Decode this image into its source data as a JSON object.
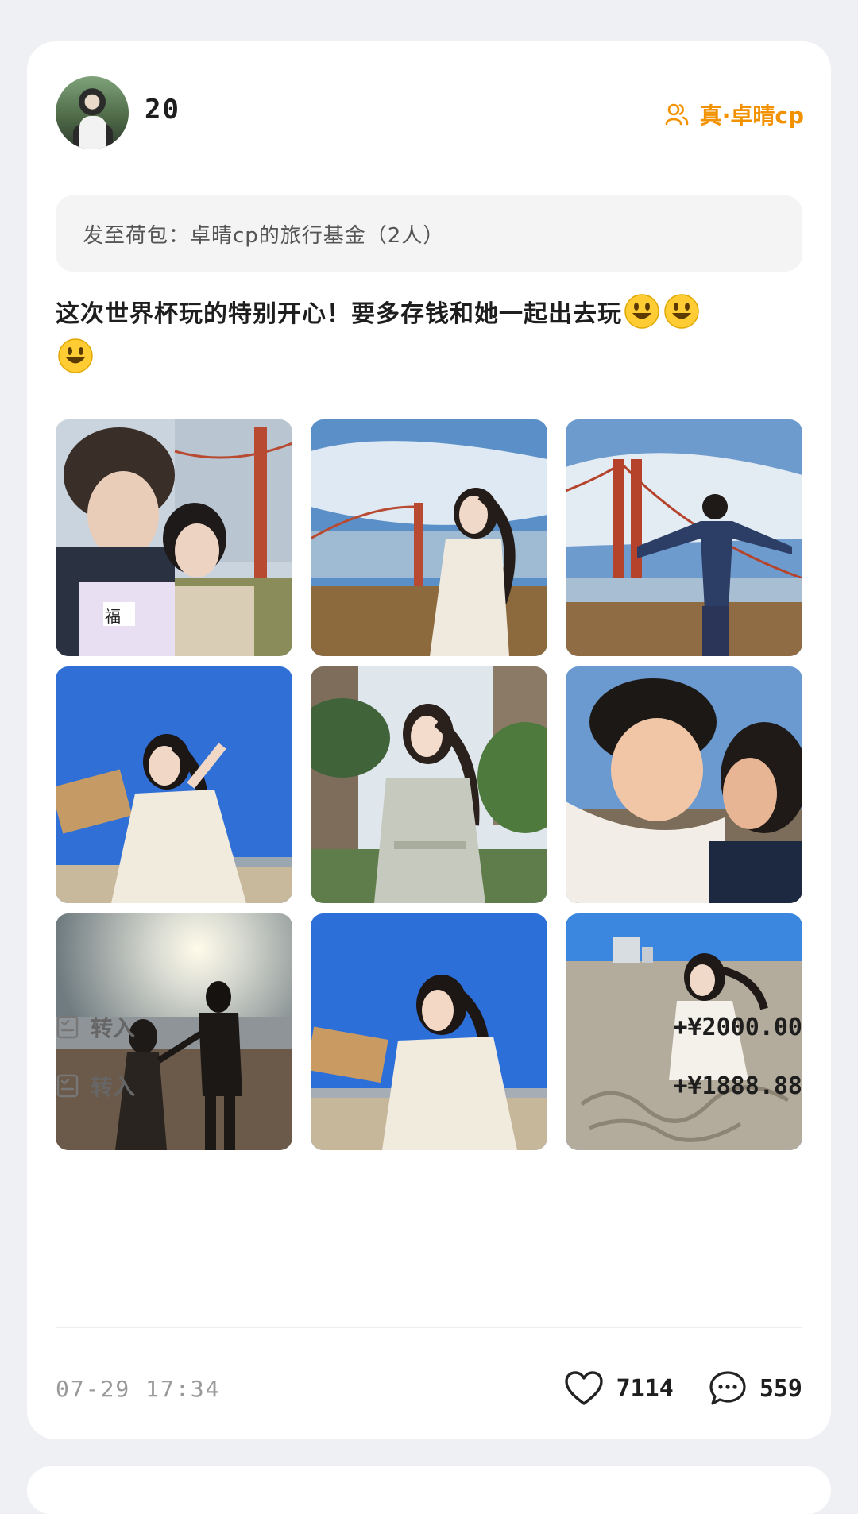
{
  "post": {
    "username": "20",
    "circle_tag": "真·卓晴cp",
    "destination": "发至荷包：卓晴cp的旅行基金（2人）",
    "text": "这次世界杯玩的特别开心！要多存钱和她一起出去玩",
    "emoji_count": 3,
    "photos": [
      {
        "label": "photo-couple-selfie-bridge"
      },
      {
        "label": "photo-woman-golden-gate"
      },
      {
        "label": "photo-man-arms-open-bridge"
      },
      {
        "label": "photo-woman-beach-box"
      },
      {
        "label": "photo-woman-palace-fine-arts"
      },
      {
        "label": "photo-couple-selfie-sunset"
      },
      {
        "label": "photo-couple-silhouette-beach"
      },
      {
        "label": "photo-woman-beach-hair"
      },
      {
        "label": "photo-woman-writing-sand"
      }
    ],
    "transfers": [
      {
        "label": "转入",
        "amount": "+¥2000.00"
      },
      {
        "label": "转入",
        "amount": "+¥1888.88"
      }
    ],
    "timestamp": "07-29 17:34",
    "likes": "7114",
    "comments": "559"
  },
  "colors": {
    "accent": "#f39200",
    "background": "#eef0f3",
    "card": "#ffffff"
  },
  "icons": {
    "circle": "people-icon",
    "transfer": "receipt-icon",
    "like": "heart-icon",
    "comment": "chat-bubble-icon"
  }
}
